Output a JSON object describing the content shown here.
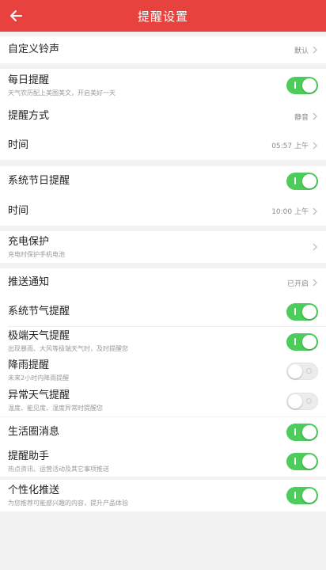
{
  "header": {
    "title": "提醒设置"
  },
  "ringtone": {
    "label": "自定义铃声",
    "value": "默认"
  },
  "daily": {
    "label": "每日提醒",
    "sub": "天气农历配上美图美文，开启美好一天",
    "enabled": true,
    "mode_label": "提醒方式",
    "mode_value": "静音",
    "time_label": "时间",
    "time_value": "05:57 上午"
  },
  "holiday": {
    "label": "系统节日提醒",
    "enabled": true,
    "time_label": "时间",
    "time_value": "10:00 上午"
  },
  "charging": {
    "label": "充电保护",
    "sub": "充电时保护手机电池"
  },
  "push": {
    "label": "推送通知",
    "value": "已开启",
    "items": [
      {
        "label": "系统节气提醒",
        "sub": "",
        "enabled": true
      },
      {
        "label": "极端天气提醒",
        "sub": "出现暴雨、大风等极端天气时，及时提醒您",
        "enabled": true
      },
      {
        "label": "降雨提醒",
        "sub": "未来2小时内降雨提醒",
        "enabled": false
      },
      {
        "label": "异常天气提醒",
        "sub": "温度、能见度、湿度异常时提醒您",
        "enabled": false
      }
    ]
  },
  "social": {
    "items": [
      {
        "label": "生活圈消息",
        "sub": "",
        "enabled": true
      },
      {
        "label": "提醒助手",
        "sub": "热点资讯、运营活动及其它事项推送",
        "enabled": true
      }
    ]
  },
  "personal": {
    "label": "个性化推送",
    "sub": "为您推荐可能感兴趣的内容，提升产品体验",
    "enabled": true
  },
  "colors": {
    "accent": "#e8423f",
    "toggle_on": "#4ccc5b"
  },
  "icons": {
    "back": "back-arrow-icon",
    "chevron": "chevron-right-icon"
  }
}
